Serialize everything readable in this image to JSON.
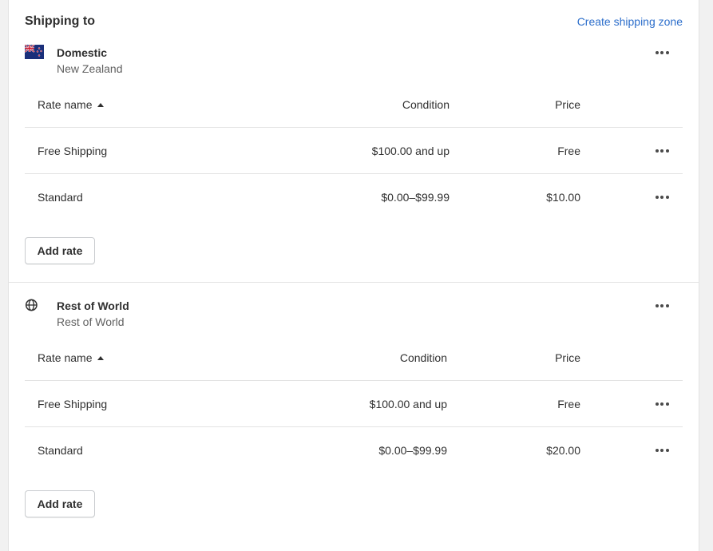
{
  "header": {
    "title": "Shipping to",
    "create_link": "Create shipping zone"
  },
  "zones": [
    {
      "name": "Domestic",
      "subtitle": "New Zealand",
      "icon": "nz-flag-icon",
      "columns": {
        "name": "Rate name",
        "condition": "Condition",
        "price": "Price"
      },
      "rates": [
        {
          "name": "Free Shipping",
          "condition": "$100.00 and up",
          "price": "Free"
        },
        {
          "name": "Standard",
          "condition": "$0.00–$99.99",
          "price": "$10.00"
        }
      ],
      "add_rate_label": "Add rate"
    },
    {
      "name": "Rest of World",
      "subtitle": "Rest of World",
      "icon": "globe-icon",
      "columns": {
        "name": "Rate name",
        "condition": "Condition",
        "price": "Price"
      },
      "rates": [
        {
          "name": "Free Shipping",
          "condition": "$100.00 and up",
          "price": "Free"
        },
        {
          "name": "Standard",
          "condition": "$0.00–$99.99",
          "price": "$20.00"
        }
      ],
      "add_rate_label": "Add rate"
    }
  ],
  "colors": {
    "link": "#2c6ecb",
    "text": "#303030",
    "subdued": "#616161",
    "border": "#e3e3e3"
  }
}
